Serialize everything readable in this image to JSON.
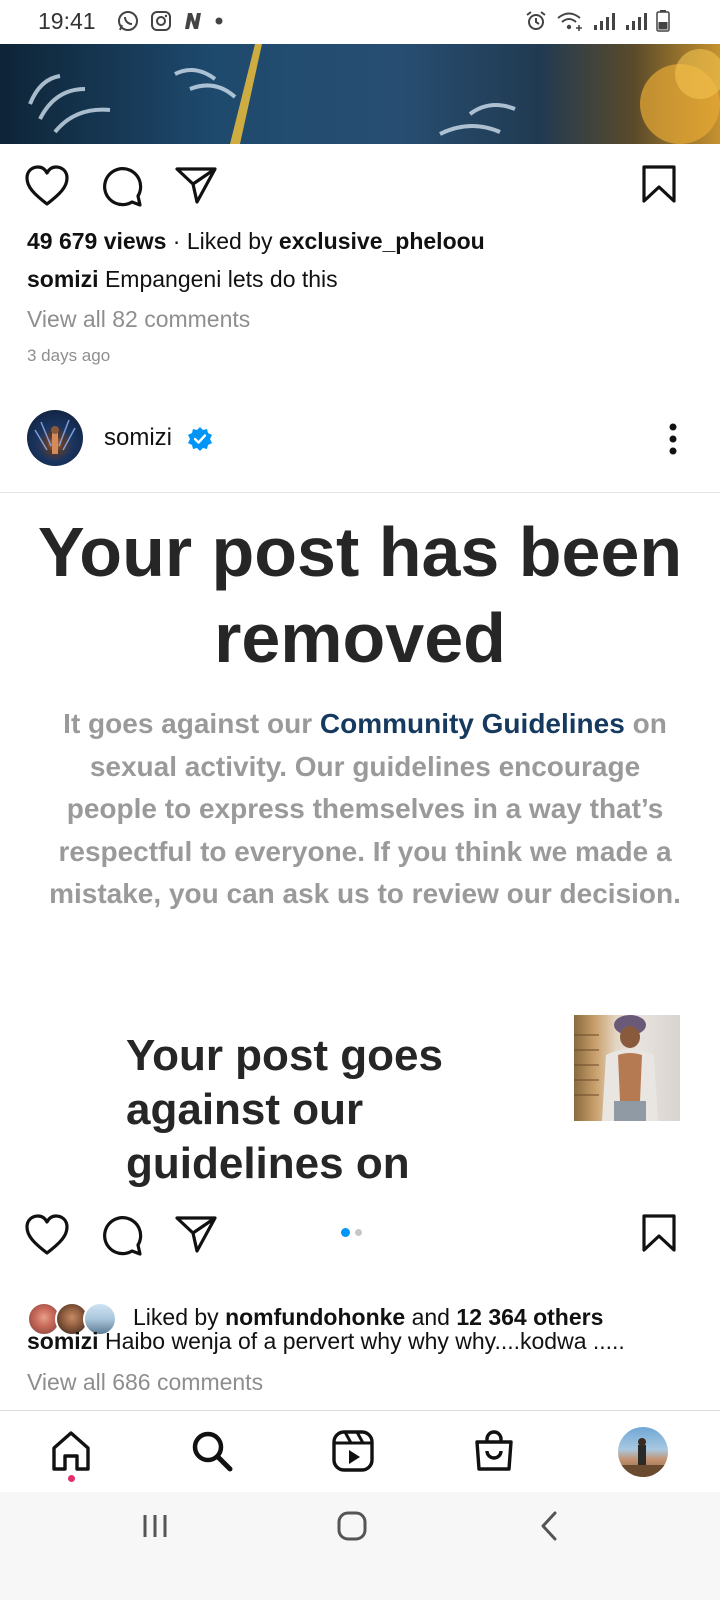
{
  "status_bar": {
    "time": "19:41"
  },
  "post1": {
    "views": "49 679 views",
    "liked_by_prefix": "Liked by",
    "liked_by_user": "exclusive_pheloou",
    "caption_user": "somizi",
    "caption_text": "Empangeni lets do this",
    "view_comments": "View all 82 comments",
    "time_ago": "3 days ago"
  },
  "post2": {
    "username": "somizi",
    "image": {
      "title": "Your post has been removed",
      "body_before": "It goes against our ",
      "body_link": "Community Guidelines",
      "body_after": " on sexual activity. Our guidelines encourage people to express themselves in a way that’s respectful to everyone. If you think we made a mistake, you can ask us to review our decision.",
      "subtitle": "Your post goes against our guidelines on"
    },
    "carousel": {
      "count": 2,
      "active": 1
    },
    "liked_by_prefix": "Liked by",
    "liked_by_user": "nomfundohonke",
    "and_text": "and",
    "others": "12 364 others",
    "caption_user": "somizi",
    "caption_text": "Haibo wenja of a pervert why why why....kodwa .....",
    "view_comments": "View all 686 comments"
  },
  "bottom_nav": {
    "items": [
      "home-icon",
      "search-icon",
      "reels-icon",
      "shop-icon",
      "profile-avatar"
    ],
    "active": "home"
  },
  "colors": {
    "accent_blue": "#0095f6",
    "notification_dot": "#e1306c",
    "link": "#163a5f"
  }
}
